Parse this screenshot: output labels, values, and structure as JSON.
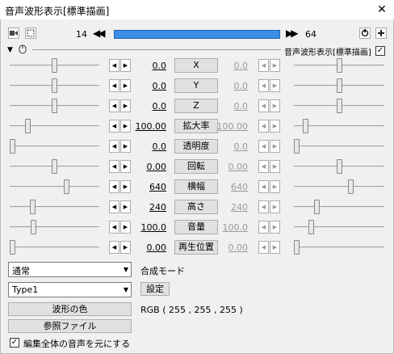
{
  "window": {
    "title": "音声波形表示[標準描画]",
    "close_glyph": "✕"
  },
  "timeline": {
    "start_frame": "14",
    "end_frame": "64",
    "prev_glyph": "◀◀",
    "next_glyph": "▶▶",
    "bar_color": "#3c8fe8"
  },
  "header": {
    "filter_name": "音声波形表示[標準描画]",
    "filter_enabled": true
  },
  "params": [
    {
      "name": "X",
      "left_value": "0.0",
      "right_value": "0.0",
      "left_pos": 0.5,
      "right_pos": 0.5
    },
    {
      "name": "Y",
      "left_value": "0.0",
      "right_value": "0.0",
      "left_pos": 0.5,
      "right_pos": 0.5
    },
    {
      "name": "Z",
      "left_value": "0.0",
      "right_value": "0.0",
      "left_pos": 0.5,
      "right_pos": 0.5
    },
    {
      "name": "拡大率",
      "left_value": "100.00",
      "right_value": "100.00",
      "left_pos": 0.18,
      "right_pos": 0.1
    },
    {
      "name": "透明度",
      "left_value": "0.0",
      "right_value": "0.0",
      "left_pos": 0.0,
      "right_pos": 0.0
    },
    {
      "name": "回転",
      "left_value": "0.00",
      "right_value": "0.00",
      "left_pos": 0.5,
      "right_pos": 0.5
    },
    {
      "name": "横幅",
      "left_value": "640",
      "right_value": "640",
      "left_pos": 0.64,
      "right_pos": 0.64
    },
    {
      "name": "高さ",
      "left_value": "240",
      "right_value": "240",
      "left_pos": 0.24,
      "right_pos": 0.24
    },
    {
      "name": "音量",
      "left_value": "100.0",
      "right_value": "100.0",
      "left_pos": 0.25,
      "right_pos": 0.17
    },
    {
      "name": "再生位置",
      "left_value": "0.00",
      "right_value": "0.00",
      "left_pos": 0.0,
      "right_pos": 0.0
    }
  ],
  "blend_mode": {
    "value": "通常",
    "label": "合成モード"
  },
  "type": {
    "value": "Type1",
    "settings_label": "設定"
  },
  "wave_color": {
    "button_label": "波形の色",
    "rgb_text": "RGB ( 255 , 255 , 255 )"
  },
  "reference_file": {
    "button_label": "参照ファイル"
  },
  "whole_audio": {
    "label": "編集全体の音声を元にする",
    "checked": true
  }
}
